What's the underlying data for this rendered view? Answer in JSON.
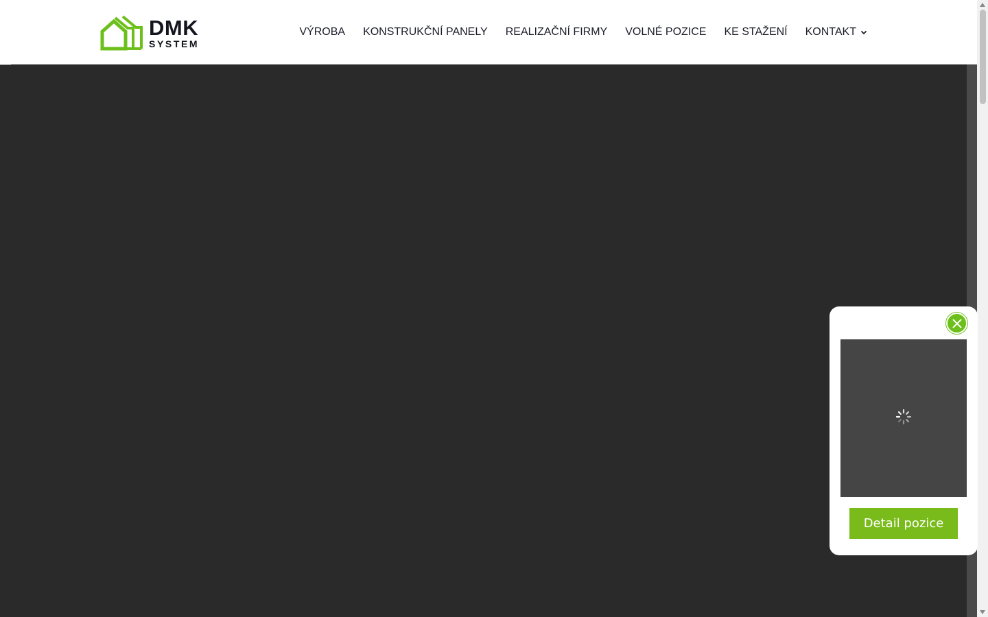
{
  "brand": {
    "name": "DMK",
    "subname": "SYSTEM",
    "logo_icon": "house-outline-icon",
    "accent_color": "#6dbf1b"
  },
  "nav": {
    "items": [
      {
        "label": "VÝROBA"
      },
      {
        "label": "KONSTRUKČNÍ PANELY"
      },
      {
        "label": "REALIZAČNÍ FIRMY"
      },
      {
        "label": "VOLNÉ POZICE"
      },
      {
        "label": "KE STAŽENÍ"
      },
      {
        "label": "KONTAKT",
        "has_dropdown": true,
        "icon": "chevron-down-icon"
      }
    ]
  },
  "hero": {
    "background_color": "#2a2a2a"
  },
  "popup": {
    "close_icon": "close-icon",
    "media_state": "loading",
    "media_icon": "loading-spinner-icon",
    "button_label": "Detail pozice",
    "button_color": "#79bb1a"
  }
}
